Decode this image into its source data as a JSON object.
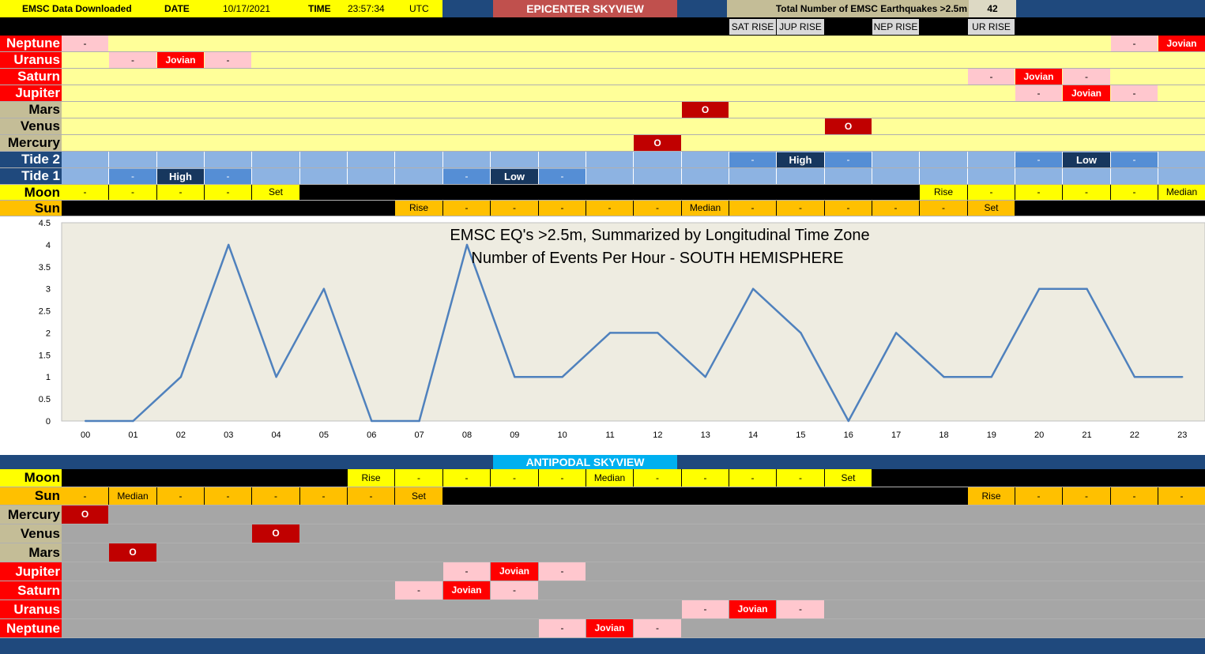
{
  "header": {
    "downloaded_label": "EMSC Data Downloaded",
    "date_label": "DATE",
    "date_value": "10/17/2021",
    "time_label": "TIME",
    "time_value": "23:57:34",
    "tz": "UTC",
    "title": "EPICENTER SKYVIEW",
    "total_label": "Total Number of EMSC Earthquakes >2.5m",
    "total_value": "42"
  },
  "rise_labels": [
    {
      "hour": 15,
      "text": "SAT RISE"
    },
    {
      "hour": 16,
      "text": "JUP RISE"
    },
    {
      "hour": 18,
      "text": "NEP RISE"
    },
    {
      "hour": 20,
      "text": "UR RISE"
    }
  ],
  "colors": {
    "navy": "#1f497d",
    "tan": "#c4bd97",
    "red_label": "#ff0000",
    "pale_yellow": "#ffff99",
    "gray": "#a6a6a6",
    "pink": "#ffc7ce",
    "planet_red": "#ff0000",
    "dark_red": "#c00000",
    "tide_light": "#8db3e2",
    "tide_mid": "#558ed5",
    "tide_dark": "#17375e",
    "yellow": "#ffff00",
    "orange": "#ffc000",
    "title_red": "#c0504d",
    "cyan": "#00b0f0",
    "line": "#4f81bd",
    "plot_bg": "#eeece1"
  },
  "epicenter_rows": [
    {
      "label": "Neptune",
      "labelStyle": "red",
      "bg": "pale_yellow",
      "cells": [
        [
          0,
          "-",
          "pink"
        ],
        [
          22,
          "-",
          "pink"
        ],
        [
          23,
          "Jovian",
          "planet_red"
        ]
      ]
    },
    {
      "label": "Uranus",
      "labelStyle": "red",
      "bg": "pale_yellow",
      "cells": [
        [
          1,
          "-",
          "pink"
        ],
        [
          2,
          "Jovian",
          "planet_red"
        ],
        [
          3,
          "-",
          "pink"
        ]
      ]
    },
    {
      "label": "Saturn",
      "labelStyle": "red",
      "bg": "pale_yellow",
      "cells": [
        [
          19,
          "-",
          "pink"
        ],
        [
          20,
          "Jovian",
          "planet_red"
        ],
        [
          21,
          "-",
          "pink"
        ]
      ]
    },
    {
      "label": "Jupiter",
      "labelStyle": "red",
      "bg": "pale_yellow",
      "cells": [
        [
          20,
          "-",
          "pink"
        ],
        [
          21,
          "Jovian",
          "planet_red"
        ],
        [
          22,
          "-",
          "pink"
        ]
      ]
    },
    {
      "label": "Mars",
      "labelStyle": "tan",
      "bg": "pale_yellow",
      "cells": [
        [
          13,
          "O",
          "dark_red"
        ]
      ]
    },
    {
      "label": "Venus",
      "labelStyle": "tan",
      "bg": "pale_yellow",
      "cells": [
        [
          16,
          "O",
          "dark_red"
        ]
      ]
    },
    {
      "label": "Mercury",
      "labelStyle": "tan",
      "bg": "pale_yellow",
      "cells": [
        [
          12,
          "O",
          "dark_red"
        ]
      ]
    },
    {
      "label": "Tide 2",
      "labelStyle": "navy",
      "bg": "tide_light",
      "cells": [
        [
          14,
          "-",
          "tide_mid"
        ],
        [
          15,
          "High",
          "tide_dark"
        ],
        [
          16,
          "-",
          "tide_mid"
        ],
        [
          20,
          "-",
          "tide_mid"
        ],
        [
          21,
          "Low",
          "tide_dark"
        ],
        [
          22,
          "-",
          "tide_mid"
        ]
      ]
    },
    {
      "label": "Tide 1",
      "labelStyle": "navy",
      "bg": "tide_light",
      "cells": [
        [
          1,
          "-",
          "tide_mid"
        ],
        [
          2,
          "High",
          "tide_dark"
        ],
        [
          3,
          "-",
          "tide_mid"
        ],
        [
          8,
          "-",
          "tide_mid"
        ],
        [
          9,
          "Low",
          "tide_dark"
        ],
        [
          10,
          "-",
          "tide_mid"
        ]
      ]
    },
    {
      "label": "Moon",
      "labelStyle": "yellow",
      "bg": "black",
      "cells": [
        [
          0,
          "-",
          "yellow"
        ],
        [
          1,
          "-",
          "yellow"
        ],
        [
          2,
          "-",
          "yellow"
        ],
        [
          3,
          "-",
          "yellow"
        ],
        [
          4,
          "Set",
          "yellow"
        ],
        [
          18,
          "Rise",
          "yellow"
        ],
        [
          19,
          "-",
          "yellow"
        ],
        [
          20,
          "-",
          "yellow"
        ],
        [
          21,
          "-",
          "yellow"
        ],
        [
          22,
          "-",
          "yellow"
        ],
        [
          23,
          "Median",
          "yellow"
        ]
      ]
    },
    {
      "label": "Sun",
      "labelStyle": "orange",
      "bg": "black",
      "cells": [
        [
          7,
          "Rise",
          "orange"
        ],
        [
          8,
          "-",
          "orange"
        ],
        [
          9,
          "-",
          "orange"
        ],
        [
          10,
          "-",
          "orange"
        ],
        [
          11,
          "-",
          "orange"
        ],
        [
          12,
          "-",
          "orange"
        ],
        [
          13,
          "Median",
          "orange"
        ],
        [
          14,
          "-",
          "orange"
        ],
        [
          15,
          "-",
          "orange"
        ],
        [
          16,
          "-",
          "orange"
        ],
        [
          17,
          "-",
          "orange"
        ],
        [
          18,
          "-",
          "orange"
        ],
        [
          19,
          "Set",
          "orange"
        ]
      ]
    }
  ],
  "antipodal_title": "ANTIPODAL SKYVIEW",
  "antipodal_rows": [
    {
      "label": "Moon",
      "labelStyle": "yellow",
      "bg": "black",
      "cells": [
        [
          6,
          "Rise",
          "yellow"
        ],
        [
          7,
          "-",
          "yellow"
        ],
        [
          8,
          "-",
          "yellow"
        ],
        [
          9,
          "-",
          "yellow"
        ],
        [
          10,
          "-",
          "yellow"
        ],
        [
          11,
          "Median",
          "yellow"
        ],
        [
          12,
          "-",
          "yellow"
        ],
        [
          13,
          "-",
          "yellow"
        ],
        [
          14,
          "-",
          "yellow"
        ],
        [
          15,
          "-",
          "yellow"
        ],
        [
          16,
          "Set",
          "yellow"
        ]
      ]
    },
    {
      "label": "Sun",
      "labelStyle": "orange",
      "bg": "black",
      "cells": [
        [
          0,
          "-",
          "orange"
        ],
        [
          1,
          "Median",
          "orange"
        ],
        [
          2,
          "-",
          "orange"
        ],
        [
          3,
          "-",
          "orange"
        ],
        [
          4,
          "-",
          "orange"
        ],
        [
          5,
          "-",
          "orange"
        ],
        [
          6,
          "-",
          "orange"
        ],
        [
          7,
          "Set",
          "orange"
        ],
        [
          19,
          "Rise",
          "orange"
        ],
        [
          20,
          "-",
          "orange"
        ],
        [
          21,
          "-",
          "orange"
        ],
        [
          22,
          "-",
          "orange"
        ],
        [
          23,
          "-",
          "orange"
        ]
      ]
    },
    {
      "label": "Mercury",
      "labelStyle": "tan",
      "bg": "gray",
      "cells": [
        [
          0,
          "O",
          "dark_red"
        ]
      ]
    },
    {
      "label": "Venus",
      "labelStyle": "tan",
      "bg": "gray",
      "cells": [
        [
          4,
          "O",
          "dark_red"
        ]
      ]
    },
    {
      "label": "Mars",
      "labelStyle": "tan",
      "bg": "gray",
      "cells": [
        [
          1,
          "O",
          "dark_red"
        ]
      ]
    },
    {
      "label": "Jupiter",
      "labelStyle": "red",
      "bg": "gray",
      "cells": [
        [
          8,
          "-",
          "pink"
        ],
        [
          9,
          "Jovian",
          "planet_red"
        ],
        [
          10,
          "-",
          "pink"
        ]
      ]
    },
    {
      "label": "Saturn",
      "labelStyle": "red",
      "bg": "gray",
      "cells": [
        [
          7,
          "-",
          "pink"
        ],
        [
          8,
          "Jovian",
          "planet_red"
        ],
        [
          9,
          "-",
          "pink"
        ]
      ]
    },
    {
      "label": "Uranus",
      "labelStyle": "red",
      "bg": "gray",
      "cells": [
        [
          13,
          "-",
          "pink"
        ],
        [
          14,
          "Jovian",
          "planet_red"
        ],
        [
          15,
          "-",
          "pink"
        ]
      ]
    },
    {
      "label": "Neptune",
      "labelStyle": "red",
      "bg": "gray",
      "cells": [
        [
          10,
          "-",
          "pink"
        ],
        [
          11,
          "Jovian",
          "planet_red"
        ],
        [
          12,
          "-",
          "pink"
        ]
      ]
    }
  ],
  "chart_data": {
    "type": "line",
    "title": "EMSC EQ's >2.5m, Summarized by Longitudinal Time Zone",
    "subtitle": "Number of Events Per Hour - SOUTH HEMISPHERE",
    "categories": [
      "00",
      "01",
      "02",
      "03",
      "04",
      "05",
      "06",
      "07",
      "08",
      "09",
      "10",
      "11",
      "12",
      "13",
      "14",
      "15",
      "16",
      "17",
      "18",
      "19",
      "20",
      "21",
      "22",
      "23"
    ],
    "values": [
      0,
      0,
      1,
      4,
      1,
      3,
      0,
      0,
      4,
      1,
      1,
      2,
      2,
      1,
      3,
      2,
      0,
      2,
      1,
      1,
      3,
      3,
      1,
      1
    ],
    "ylim": [
      0,
      4.5
    ],
    "yticks": [
      "0",
      "0.5",
      "1",
      "1.5",
      "2",
      "2.5",
      "3",
      "3.5",
      "4",
      "4.5"
    ],
    "grid": false,
    "legend": "none"
  }
}
